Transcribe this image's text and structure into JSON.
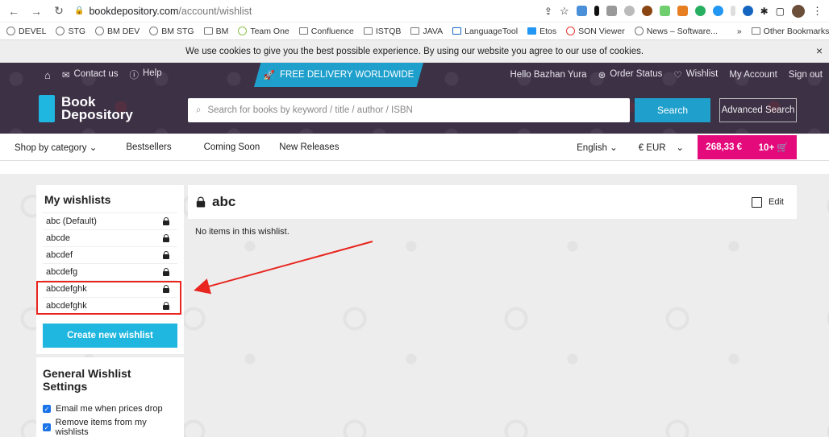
{
  "browser": {
    "url_domain": "bookdepository.com",
    "url_path": "/account/wishlist",
    "bookmarks": [
      "DEVEL",
      "STG",
      "BM DEV",
      "BM STG",
      "BM",
      "Team One",
      "Confluence",
      "ISTQB",
      "JAVA",
      "LanguageTool",
      "Etos",
      "SON Viewer",
      "News – Software..."
    ],
    "more": "»",
    "other_bookmarks": "Other Bookmarks"
  },
  "cookie": {
    "text": "We use cookies to give you the best possible experience. By using our website you agree to our use of cookies.",
    "close": "×"
  },
  "topbar": {
    "contact": "Contact us",
    "help": "Help",
    "delivery": "FREE DELIVERY WORLDWIDE",
    "greeting": "Hello Bazhan Yura",
    "order_status": "Order Status",
    "wishlist": "Wishlist",
    "account": "My Account",
    "signout": "Sign out"
  },
  "logo": {
    "line1": "Book",
    "line2": "Depository"
  },
  "search": {
    "placeholder": "Search for books by keyword / title / author / ISBN",
    "button": "Search",
    "advanced": "Advanced Search"
  },
  "nav": {
    "category": "Shop by category",
    "bestsellers": "Bestsellers",
    "coming_soon": "Coming Soon",
    "new_releases": "New Releases",
    "language": "English",
    "currency": "€ EUR",
    "basket_total": "268,33 €",
    "basket_count": "10+"
  },
  "sidebar": {
    "title": "My wishlists",
    "items": [
      "abc (Default)",
      "abcde",
      "abcdef",
      "abcdefg",
      "abcdefghk",
      "abcdefghk"
    ],
    "create_button": "Create new wishlist"
  },
  "settings": {
    "title": "General Wishlist Settings",
    "options": [
      "Email me when prices drop",
      "Remove items from my wishlists"
    ]
  },
  "wishlist": {
    "name": "abc",
    "edit": "Edit",
    "empty_text": "No items in this wishlist."
  },
  "colors": {
    "header": "#3d3146",
    "accent": "#1fa0cc",
    "basket": "#e40a7b",
    "annotation": "#e8261f"
  }
}
